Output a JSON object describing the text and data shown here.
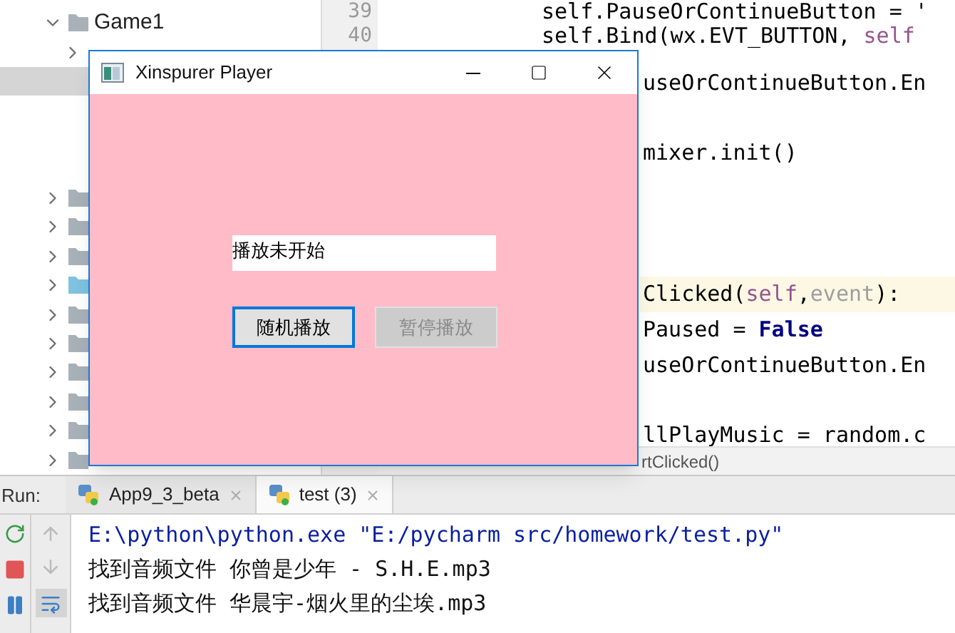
{
  "project_tree": {
    "items": [
      {
        "label": "Game1",
        "expanded": true,
        "selected": false,
        "color": "#a9b1b8",
        "children": [
          {
            "expanded": false,
            "selected": false
          },
          {
            "selected": true
          }
        ]
      },
      {
        "expanded": false,
        "selected": false,
        "color": "#a9b1b8"
      },
      {
        "expanded": false,
        "selected": false,
        "color": "#a9b1b8"
      },
      {
        "expanded": false,
        "selected": false,
        "color": "#a9b1b8"
      },
      {
        "expanded": false,
        "selected": false,
        "color": "#7fc3e0"
      },
      {
        "expanded": false,
        "selected": false,
        "color": "#a9b1b8"
      },
      {
        "expanded": false,
        "selected": false,
        "color": "#a9b1b8"
      },
      {
        "expanded": false,
        "selected": false,
        "color": "#a9b1b8"
      },
      {
        "expanded": false,
        "selected": false,
        "color": "#a9b1b8"
      },
      {
        "expanded": false,
        "selected": false,
        "color": "#a9b1b8"
      },
      {
        "expanded": false,
        "selected": false,
        "color": "#a9b1b8"
      }
    ]
  },
  "editor": {
    "line_numbers": [
      "39",
      "40"
    ],
    "lines": [
      {
        "current": false,
        "segments": [
          {
            "kind": "plain",
            "text": "self.PauseOrContinueButton = '"
          }
        ]
      },
      {
        "current": false,
        "segments": [
          {
            "kind": "plain",
            "text": "self.Bind(wx.EVT_BUTTON, "
          },
          {
            "kind": "self",
            "text": "self"
          }
        ]
      },
      {
        "current": false,
        "segments": [
          {
            "kind": "plain",
            "text": "useOrContinueButton.En"
          }
        ]
      },
      {
        "current": false
      },
      {
        "current": false,
        "segments": [
          {
            "kind": "plain",
            "text": "mixer.init()"
          }
        ]
      },
      {
        "current": false
      },
      {
        "current": false
      },
      {
        "current": false
      },
      {
        "current": true,
        "segments": [
          {
            "kind": "plain",
            "text": "Clicked("
          },
          {
            "kind": "self",
            "text": "self"
          },
          {
            "kind": "plain",
            "text": ","
          },
          {
            "kind": "param",
            "text": "event"
          },
          {
            "kind": "plain",
            "text": "):"
          }
        ]
      },
      {
        "current": false,
        "segments": [
          {
            "kind": "plain",
            "text": "Paused = "
          },
          {
            "kind": "keyword",
            "text": "False"
          }
        ]
      },
      {
        "current": false,
        "segments": [
          {
            "kind": "plain",
            "text": "useOrContinueButton.En"
          }
        ]
      },
      {
        "current": false
      },
      {
        "current": false,
        "segments": [
          {
            "kind": "plain",
            "text": "llPlayMusic = random.c"
          }
        ]
      }
    ],
    "breadcrumb": "rtClicked()"
  },
  "player_window": {
    "title": "Xinspurer Player",
    "status_field": {
      "value": "播放未开始"
    },
    "buttons": [
      {
        "label": "随机播放",
        "focused": true,
        "disabled": false
      },
      {
        "label": "暂停播放",
        "focused": false,
        "disabled": true
      }
    ]
  },
  "run_panel": {
    "label": "Run:",
    "tabs": [
      {
        "label": "App9_3_beta",
        "selected": false
      },
      {
        "label": "test (3)",
        "selected": true
      }
    ],
    "console": [
      {
        "kind": "command",
        "text": "E:\\python\\python.exe \"E:/pycharm src/homework/test.py\""
      },
      {
        "kind": "output",
        "text": "找到音频文件 你曾是少年 - S.H.E.mp3"
      },
      {
        "kind": "output",
        "text": "找到音频文件 华晨宇-烟火里的尘埃.mp3"
      }
    ]
  }
}
